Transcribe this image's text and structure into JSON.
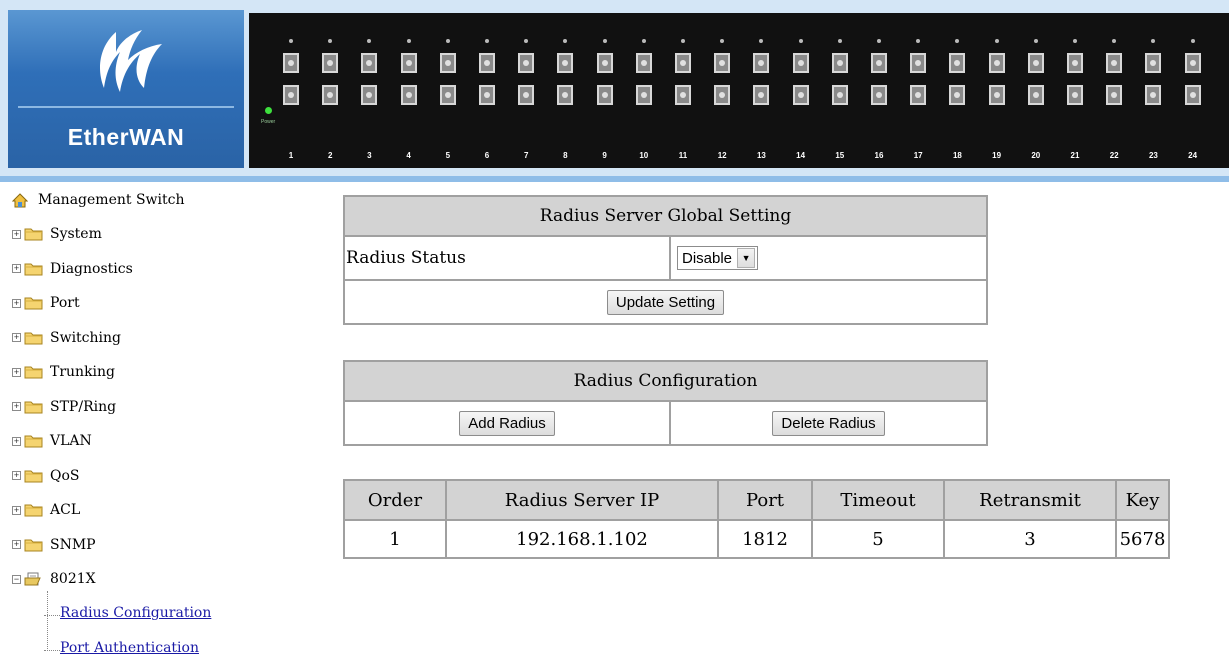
{
  "header": {
    "brand_prefix": "Ether",
    "brand_suffix": "WAN",
    "port_numbers": [
      "1",
      "2",
      "3",
      "4",
      "5",
      "6",
      "7",
      "8",
      "9",
      "10",
      "11",
      "12",
      "13",
      "14",
      "15",
      "16",
      "17",
      "18",
      "19",
      "20",
      "21",
      "22",
      "23",
      "24"
    ],
    "power_label": "Power"
  },
  "sidebar": {
    "root_label": "Management Switch",
    "items": [
      {
        "label": "System"
      },
      {
        "label": "Diagnostics"
      },
      {
        "label": "Port"
      },
      {
        "label": "Switching"
      },
      {
        "label": "Trunking"
      },
      {
        "label": "STP/Ring"
      },
      {
        "label": "VLAN"
      },
      {
        "label": "QoS"
      },
      {
        "label": "ACL"
      },
      {
        "label": "SNMP"
      },
      {
        "label": "8021X"
      }
    ],
    "sub_items": [
      {
        "label": "Radius Configuration"
      },
      {
        "label": "Port Authentication"
      }
    ]
  },
  "global_setting": {
    "title": "Radius Server Global Setting",
    "status_label": "Radius Status",
    "status_value": "Disable",
    "update_button": "Update Setting"
  },
  "configuration": {
    "title": "Radius Configuration",
    "add_button": "Add Radius",
    "delete_button": "Delete Radius"
  },
  "radius_table": {
    "columns": [
      "Order",
      "Radius Server IP",
      "Port",
      "Timeout",
      "Retransmit",
      "Key"
    ],
    "rows": [
      [
        "1",
        "192.168.1.102",
        "1812",
        "5",
        "3",
        "5678"
      ]
    ]
  },
  "colors": {
    "header_bg": "#d4e6f6",
    "logo_blue": "#2f6fb8",
    "panel_black": "#111111",
    "table_header_gray": "#d3d3d3",
    "link_blue": "#1a1aa6"
  }
}
